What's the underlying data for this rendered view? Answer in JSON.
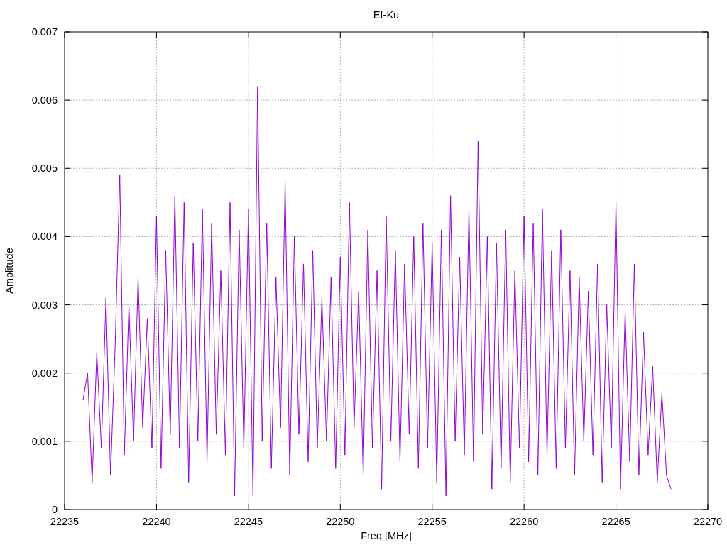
{
  "chart_data": {
    "type": "line",
    "grid": true,
    "title": "Ef-Ku",
    "xlabel": "Freq [MHz]",
    "ylabel": "Amplitude",
    "xlim": [
      22235,
      22270
    ],
    "ylim": [
      0,
      0.007
    ],
    "xticks": [
      22235,
      22240,
      22245,
      22250,
      22255,
      22260,
      22265,
      22270
    ],
    "yticks": [
      0,
      0.001,
      0.002,
      0.003,
      0.004,
      0.005,
      0.006,
      0.007
    ],
    "x": [
      22236,
      22236.25,
      22236.5,
      22236.75,
      22237,
      22237.25,
      22237.5,
      22237.75,
      22238,
      22238.25,
      22238.5,
      22238.75,
      22239,
      22239.25,
      22239.5,
      22239.75,
      22240,
      22240.25,
      22240.5,
      22240.75,
      22241,
      22241.25,
      22241.5,
      22241.75,
      22242,
      22242.25,
      22242.5,
      22242.75,
      22243,
      22243.25,
      22243.5,
      22243.75,
      22244,
      22244.25,
      22244.5,
      22244.75,
      22245,
      22245.25,
      22245.5,
      22245.75,
      22246,
      22246.25,
      22246.5,
      22246.75,
      22247,
      22247.25,
      22247.5,
      22247.75,
      22248,
      22248.25,
      22248.5,
      22248.75,
      22249,
      22249.25,
      22249.5,
      22249.75,
      22250,
      22250.25,
      22250.5,
      22250.75,
      22251,
      22251.25,
      22251.5,
      22251.75,
      22252,
      22252.25,
      22252.5,
      22252.75,
      22253,
      22253.25,
      22253.5,
      22253.75,
      22254,
      22254.25,
      22254.5,
      22254.75,
      22255,
      22255.25,
      22255.5,
      22255.75,
      22256,
      22256.25,
      22256.5,
      22256.75,
      22257,
      22257.25,
      22257.5,
      22257.75,
      22258,
      22258.25,
      22258.5,
      22258.75,
      22259,
      22259.25,
      22259.5,
      22259.75,
      22260,
      22260.25,
      22260.5,
      22260.75,
      22261,
      22261.25,
      22261.5,
      22261.75,
      22262,
      22262.25,
      22262.5,
      22262.75,
      22263,
      22263.25,
      22263.5,
      22263.75,
      22264,
      22264.25,
      22264.5,
      22264.75,
      22265,
      22265.25,
      22265.5,
      22265.75,
      22266,
      22266.25,
      22266.5,
      22266.75,
      22267,
      22267.25,
      22267.5,
      22267.75,
      22268
    ],
    "series": [
      {
        "color": "#9400d3",
        "values": [
          0.0016,
          0.002,
          0.0004,
          0.0023,
          0.0009,
          0.0031,
          0.0005,
          0.0024,
          0.0049,
          0.0008,
          0.003,
          0.001,
          0.0034,
          0.0012,
          0.0028,
          0.0009,
          0.0043,
          0.0006,
          0.0038,
          0.0011,
          0.0046,
          0.0009,
          0.0045,
          0.0004,
          0.0039,
          0.001,
          0.0044,
          0.0007,
          0.0042,
          0.0011,
          0.0035,
          0.0008,
          0.0045,
          0.0002,
          0.0041,
          0.0009,
          0.0044,
          0.0002,
          0.0062,
          0.001,
          0.0042,
          0.0006,
          0.0034,
          0.0012,
          0.0048,
          0.0005,
          0.004,
          0.0011,
          0.0036,
          0.0007,
          0.0038,
          0.0009,
          0.0031,
          0.001,
          0.0034,
          0.0006,
          0.0037,
          0.0008,
          0.0045,
          0.0012,
          0.0032,
          0.0005,
          0.0041,
          0.0009,
          0.0035,
          0.0003,
          0.0043,
          0.001,
          0.0038,
          0.0007,
          0.0036,
          0.0011,
          0.004,
          0.0006,
          0.0042,
          0.0009,
          0.0039,
          0.0004,
          0.0041,
          0.0002,
          0.0046,
          0.001,
          0.0037,
          0.0008,
          0.0044,
          0.0007,
          0.0054,
          0.0011,
          0.004,
          0.0003,
          0.0039,
          0.0006,
          0.0041,
          0.0004,
          0.0035,
          0.0009,
          0.0043,
          0.0007,
          0.0042,
          0.0005,
          0.0044,
          0.0008,
          0.0038,
          0.0006,
          0.0041,
          0.0009,
          0.0035,
          0.0005,
          0.0034,
          0.001,
          0.0032,
          0.0008,
          0.0036,
          0.0004,
          0.003,
          0.0009,
          0.0045,
          0.0003,
          0.0029,
          0.0007,
          0.0036,
          0.0005,
          0.0026,
          0.0008,
          0.0021,
          0.0004,
          0.0017,
          0.0005,
          0.0003
        ]
      }
    ]
  }
}
